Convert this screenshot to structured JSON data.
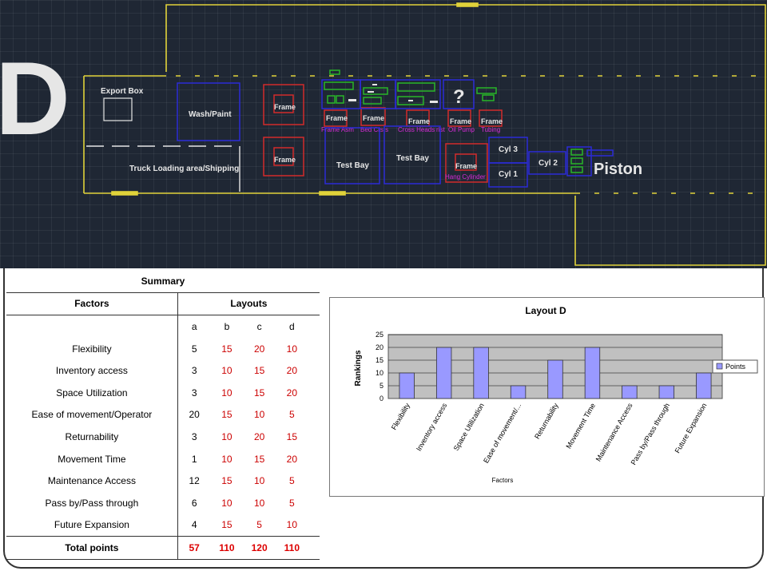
{
  "cad": {
    "big_letter": "D",
    "labels": {
      "export_box": "Export Box",
      "wash_paint": "Wash/Paint",
      "truck_loading": "Truck Loading area/Shipping",
      "frame": "Frame",
      "test_bay": "Test Bay",
      "question": "?",
      "cyl3": "Cyl 3",
      "cyl1": "Cyl 1",
      "cyl2": "Cyl 2",
      "piston": "Piston"
    },
    "sublabels": {
      "frame_asm": "Frame Asm",
      "bed_cross": "Bed Crs s",
      "cross_heads": "Cross Heads",
      "rist": "rist",
      "oil_pump": "Oil Pump",
      "tubing": "Tubing",
      "hang_cylinder": "Hang Cylinder"
    },
    "colors": {
      "background": "#1f2734",
      "wall": "#e0d23a",
      "blue": "#2b2bd6",
      "red": "#d22b2b",
      "green": "#28b528",
      "magenta": "#d82bd8",
      "letter": "#e6e6e6"
    }
  },
  "summary": {
    "title": "Summary",
    "col_factors": "Factors",
    "col_layouts": "Layouts",
    "layout_letters": [
      "a",
      "b",
      "c",
      "d"
    ],
    "rows": [
      {
        "factor": "Flexibility",
        "values": [
          "5",
          "15",
          "20",
          "10"
        ]
      },
      {
        "factor": "Inventory access",
        "values": [
          "3",
          "10",
          "15",
          "20"
        ]
      },
      {
        "factor": "Space Utilization",
        "values": [
          "3",
          "10",
          "15",
          "20"
        ]
      },
      {
        "factor": "Ease of movement/Operator",
        "values": [
          "20",
          "15",
          "10",
          "5"
        ]
      },
      {
        "factor": "Returnability",
        "values": [
          "3",
          "10",
          "20",
          "15"
        ]
      },
      {
        "factor": "Movement Time",
        "values": [
          "1",
          "10",
          "15",
          "20"
        ]
      },
      {
        "factor": "Maintenance Access",
        "values": [
          "12",
          "15",
          "10",
          "5"
        ]
      },
      {
        "factor": "Pass by/Pass through",
        "values": [
          "6",
          "10",
          "10",
          "5"
        ]
      },
      {
        "factor": "Future Expansion",
        "values": [
          "4",
          "15",
          "5",
          "10"
        ]
      }
    ],
    "total_label": "Total points",
    "totals": [
      "57",
      "110",
      "120",
      "110"
    ]
  },
  "chart_data": {
    "type": "bar",
    "title": "Layout D",
    "xlabel": "Factors",
    "ylabel": "Rankings",
    "categories": [
      "Flexibility",
      "Inventory access",
      "Space Utilization",
      "Ease of movement/...",
      "Returnability",
      "Movement Time",
      "Maintenance Access",
      "Pass by/Pass through",
      "Future Expansion"
    ],
    "series": [
      {
        "name": "Points",
        "values": [
          10,
          20,
          20,
          5,
          15,
          20,
          5,
          5,
          10
        ]
      }
    ],
    "ylim": [
      0,
      25
    ],
    "yticks": [
      "0",
      "5",
      "10",
      "15",
      "20",
      "25"
    ],
    "grid": true,
    "legend": "right",
    "colors": {
      "bar": "#9999ff",
      "plot_bg": "#c0c0c0",
      "frame": "#555555"
    }
  }
}
